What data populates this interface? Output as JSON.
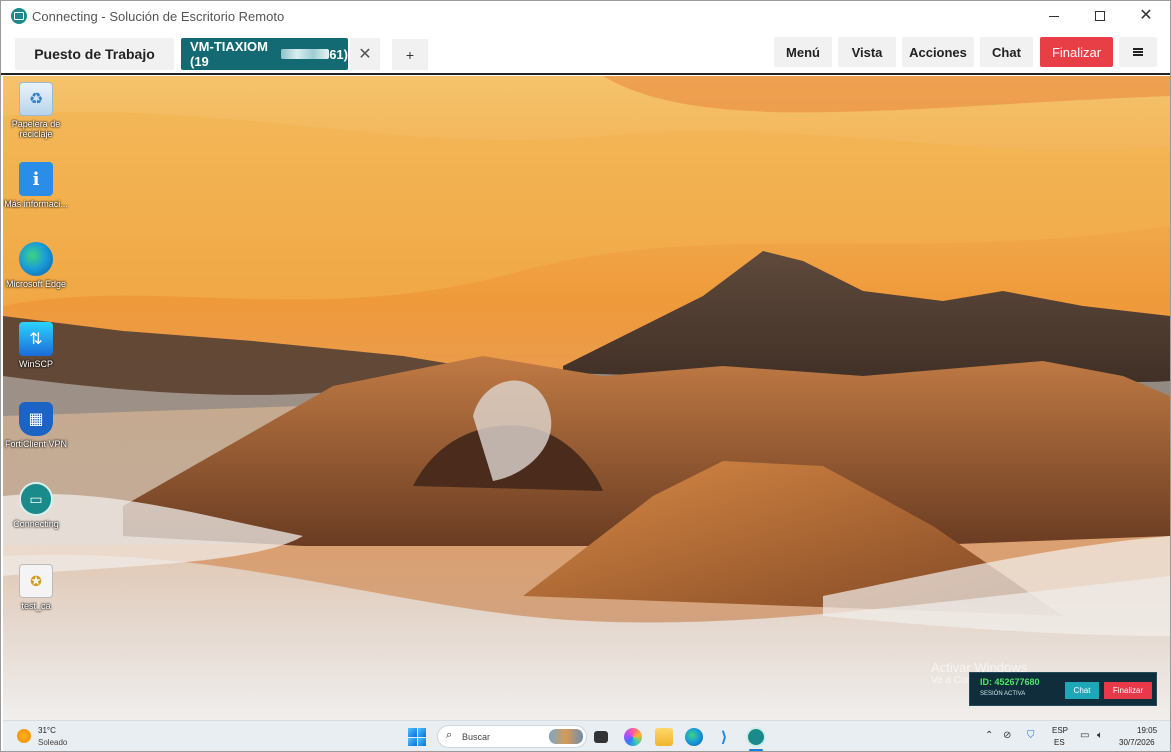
{
  "window": {
    "title": "Connecting - Solución de Escritorio Remoto",
    "icons": {
      "app": "connecting-app-icon",
      "minimize": "minimize-icon",
      "maximize": "maximize-icon",
      "close": "close-icon"
    }
  },
  "tabs": {
    "home_label": "Puesto de Trabajo",
    "active_label": "VM-TIAXIOM (19",
    "active_suffix": "61)",
    "close_glyph": "✕",
    "add_glyph": "+"
  },
  "toolbar": {
    "menu_label": "Menú",
    "view_label": "Vista",
    "actions_label": "Acciones",
    "chat_label": "Chat",
    "end_label": "Finalizar",
    "end_color": "#e83e46",
    "active_tab_color": "#146a73"
  },
  "desktop_icons": [
    {
      "label": "Papelera de reciclaje",
      "icon": "recycle-bin-icon"
    },
    {
      "label": "Más informaci...",
      "icon": "info-image-icon"
    },
    {
      "label": "Microsoft Edge",
      "icon": "edge-icon"
    },
    {
      "label": "WinSCP",
      "icon": "winscp-icon"
    },
    {
      "label": "FortiClient VPN",
      "icon": "forticlient-icon"
    },
    {
      "label": "Connecting",
      "icon": "connecting-icon"
    },
    {
      "label": "test_ca",
      "icon": "certificate-icon"
    }
  ],
  "watermark": {
    "title": "Activar Windows",
    "subtitle": "Ve a Configuración para activar Windows."
  },
  "session_panel": {
    "id_text": "ID: 452677680",
    "state_text": "SESIÓN ACTIVA",
    "chat_label": "Chat",
    "end_label": "Finalizar",
    "id_color": "#53e36a"
  },
  "taskbar": {
    "weather_temp": "31°C",
    "weather_desc": "Soleado",
    "search_placeholder": "Buscar",
    "lang_top": "ESP",
    "lang_bottom": "ES",
    "time": "19:05",
    "date": "30/7/2026",
    "icons": [
      "start-icon",
      "search-icon",
      "task-view-icon",
      "copilot-icon",
      "file-explorer-icon",
      "edge-icon",
      "vscode-icon",
      "connecting-icon",
      "chevron-up-icon",
      "network-off-icon",
      "shield-icon",
      "display-icon",
      "speaker-icon"
    ]
  }
}
